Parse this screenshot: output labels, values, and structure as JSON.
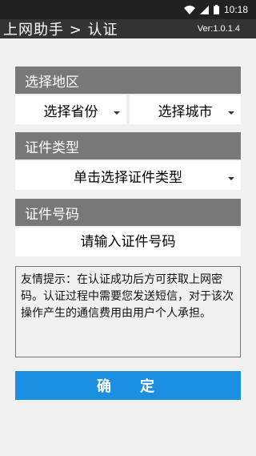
{
  "status_bar": {
    "time": "10:18",
    "icons": [
      "wifi-icon",
      "signal-icon",
      "battery-icon"
    ]
  },
  "app_bar": {
    "title": "上网助手 > 认证",
    "version": "Ver:1.0.1.4"
  },
  "region_section": {
    "header": "选择地区",
    "province_spinner": "选择省份",
    "city_spinner": "选择城市"
  },
  "cert_type_section": {
    "header": "证件类型",
    "type_spinner": "单击选择证件类型"
  },
  "cert_number_section": {
    "header": "证件号码",
    "placeholder": "请输入证件号码",
    "value": ""
  },
  "tip": {
    "text": "友情提示：在认证成功后方可获取上网密码。认证过程中需要您发送短信，对于该次操作产生的通信费用由用户个人承担。"
  },
  "confirm_button": {
    "label": "确定"
  },
  "colors": {
    "status_bar": "#212121",
    "app_bar": "#333333",
    "section_header": "#787878",
    "button": "#1b8fe2",
    "background": "#f0f0f0"
  }
}
